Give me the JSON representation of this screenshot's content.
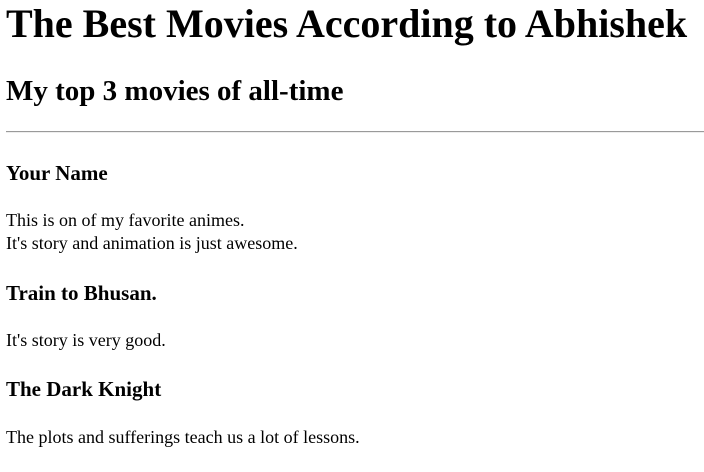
{
  "page": {
    "title": "The Best Movies According to Abhishek",
    "subtitle": "My top 3 movies of all-time"
  },
  "movies": [
    {
      "title": "Your Name",
      "description_lines": [
        "This is on of my favorite animes.",
        "It's story and animation is just awesome."
      ]
    },
    {
      "title": "Train to Bhusan.",
      "description_lines": [
        "It's story is very good."
      ]
    },
    {
      "title": "The Dark Knight",
      "description_lines": [
        "The plots and sufferings teach us a lot of lessons."
      ]
    }
  ]
}
